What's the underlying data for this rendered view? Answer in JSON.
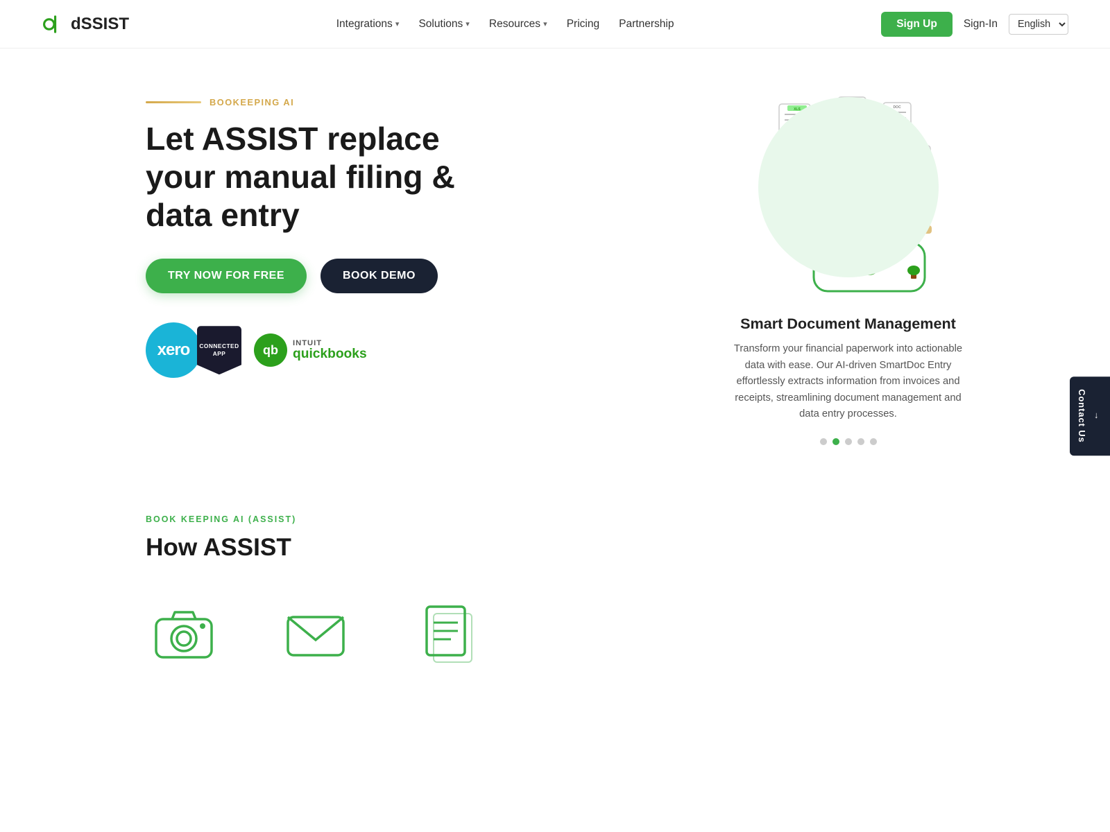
{
  "brand": {
    "name": "dSSIST",
    "logo_letter": "d"
  },
  "navbar": {
    "links": [
      {
        "label": "Integrations",
        "has_dropdown": true
      },
      {
        "label": "Solutions",
        "has_dropdown": true
      },
      {
        "label": "Resources",
        "has_dropdown": true
      },
      {
        "label": "Pricing",
        "has_dropdown": false
      },
      {
        "label": "Partnership",
        "has_dropdown": false
      }
    ],
    "signup_label": "Sign Up",
    "signin_label": "Sign-In",
    "language": "English"
  },
  "hero": {
    "badge": "BOOKEEPING AI",
    "title": "Let ASSIST replace your manual filing & data entry",
    "try_btn": "TRY NOW FOR FREE",
    "demo_btn": "BOOK DEMO",
    "xero_label": "xero",
    "connected_label": "CONNECTED\nAPP",
    "qb_intuit": "intuit",
    "qb_name": "quickbooks"
  },
  "hero_card": {
    "title": "Smart Document Management",
    "description": "Transform your financial paperwork into actionable data with ease. Our AI-driven SmartDoc Entry effortlessly extracts information from invoices and receipts, streamlining document management and data entry processes.",
    "dots": [
      {
        "active": false
      },
      {
        "active": true
      },
      {
        "active": false
      },
      {
        "active": false
      },
      {
        "active": false
      }
    ]
  },
  "contact_side": {
    "label": "Contact Us",
    "arrow": "→"
  },
  "bottom": {
    "label": "BOOK KEEPING AI (ASSIST)",
    "title": "How ASSIST"
  },
  "features": [
    {
      "icon": "camera-icon"
    },
    {
      "icon": "email-icon"
    },
    {
      "icon": "document-icon"
    }
  ]
}
